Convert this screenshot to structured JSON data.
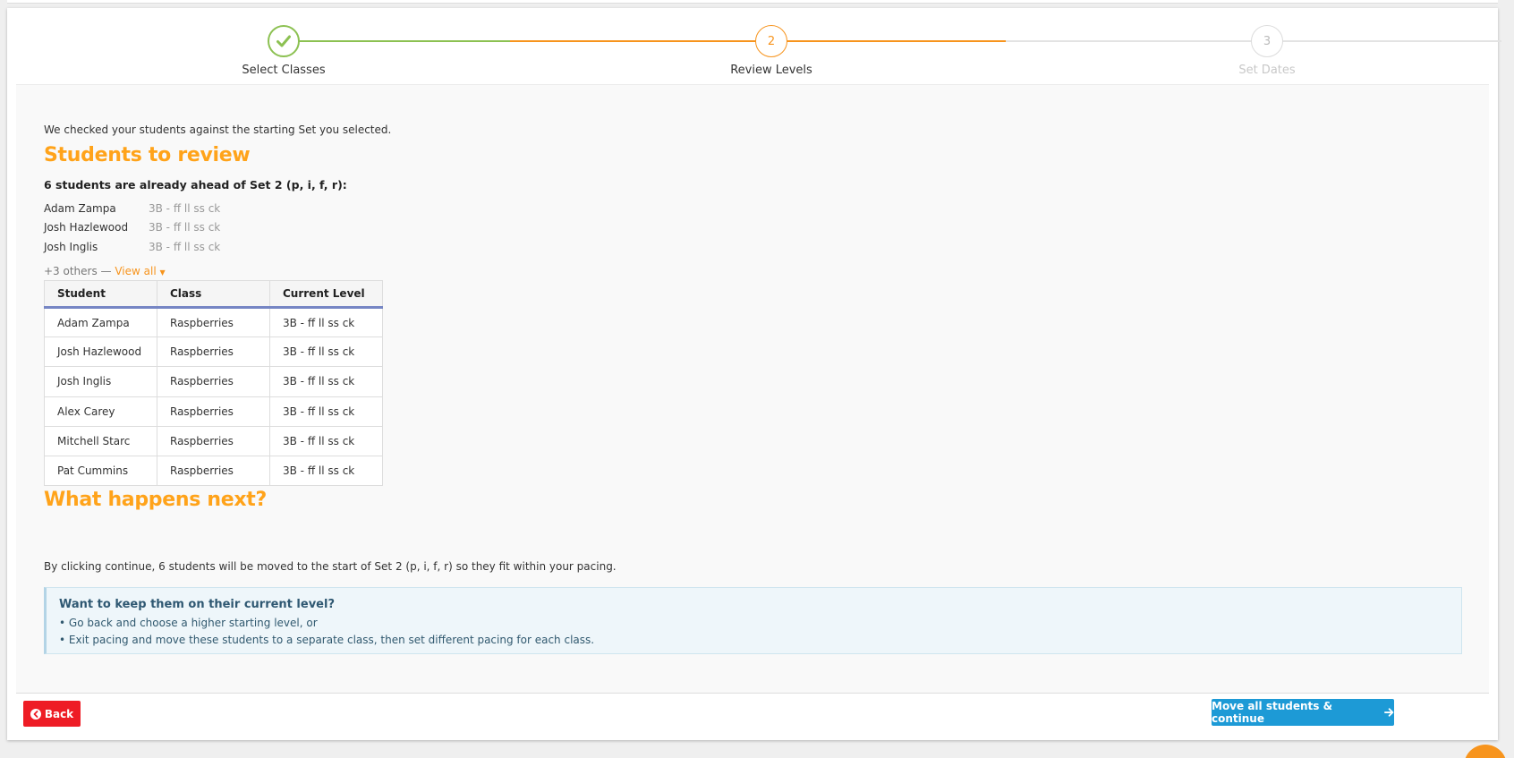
{
  "colors": {
    "done": "#8cc152",
    "active": "#f7941d",
    "pending": "#cccccc",
    "heading": "#ffa31a",
    "back_button": "#ee1c25",
    "continue_button": "#1d9ad6"
  },
  "stepper": {
    "steps": [
      {
        "number": "",
        "label": "Select Classes",
        "state": "done",
        "icon": "check-icon"
      },
      {
        "number": "2",
        "label": "Review Levels",
        "state": "active"
      },
      {
        "number": "3",
        "label": "Set Dates",
        "state": "pending"
      }
    ]
  },
  "intro": "We checked your students against the starting Set you selected.",
  "review": {
    "heading": "Students to review",
    "ahead_text": "6 students are already ahead of Set 2 (p, i, f, r):",
    "preview": [
      {
        "name": "Adam Zampa",
        "level": "3B - ff ll ss ck"
      },
      {
        "name": "Josh Hazlewood",
        "level": "3B - ff ll ss ck"
      },
      {
        "name": "Josh Inglis",
        "level": "3B - ff ll ss ck"
      }
    ],
    "others_text": "+3 others — ",
    "view_all": "View all",
    "table": {
      "headers": [
        "Student",
        "Class",
        "Current Level"
      ],
      "rows": [
        [
          "Adam Zampa",
          "Raspberries",
          "3B - ff ll ss ck"
        ],
        [
          "Josh Hazlewood",
          "Raspberries",
          "3B - ff ll ss ck"
        ],
        [
          "Josh Inglis",
          "Raspberries",
          "3B - ff ll ss ck"
        ],
        [
          "Alex Carey",
          "Raspberries",
          "3B - ff ll ss ck"
        ],
        [
          "Mitchell Starc",
          "Raspberries",
          "3B - ff ll ss ck"
        ],
        [
          "Pat Cummins",
          "Raspberries",
          "3B - ff ll ss ck"
        ]
      ]
    }
  },
  "next": {
    "heading": "What happens next?",
    "text": "By clicking continue, 6 students will be moved to the start of Set 2 (p, i, f, r) so they fit within your pacing."
  },
  "info": {
    "title": "Want to keep them on their current level?",
    "lines": [
      "• Go back and choose a higher starting level, or",
      "• Exit pacing and move these students to a separate class, then set different pacing for each class."
    ]
  },
  "footer": {
    "back_label": "Back",
    "continue_label": "Move all students & continue"
  }
}
